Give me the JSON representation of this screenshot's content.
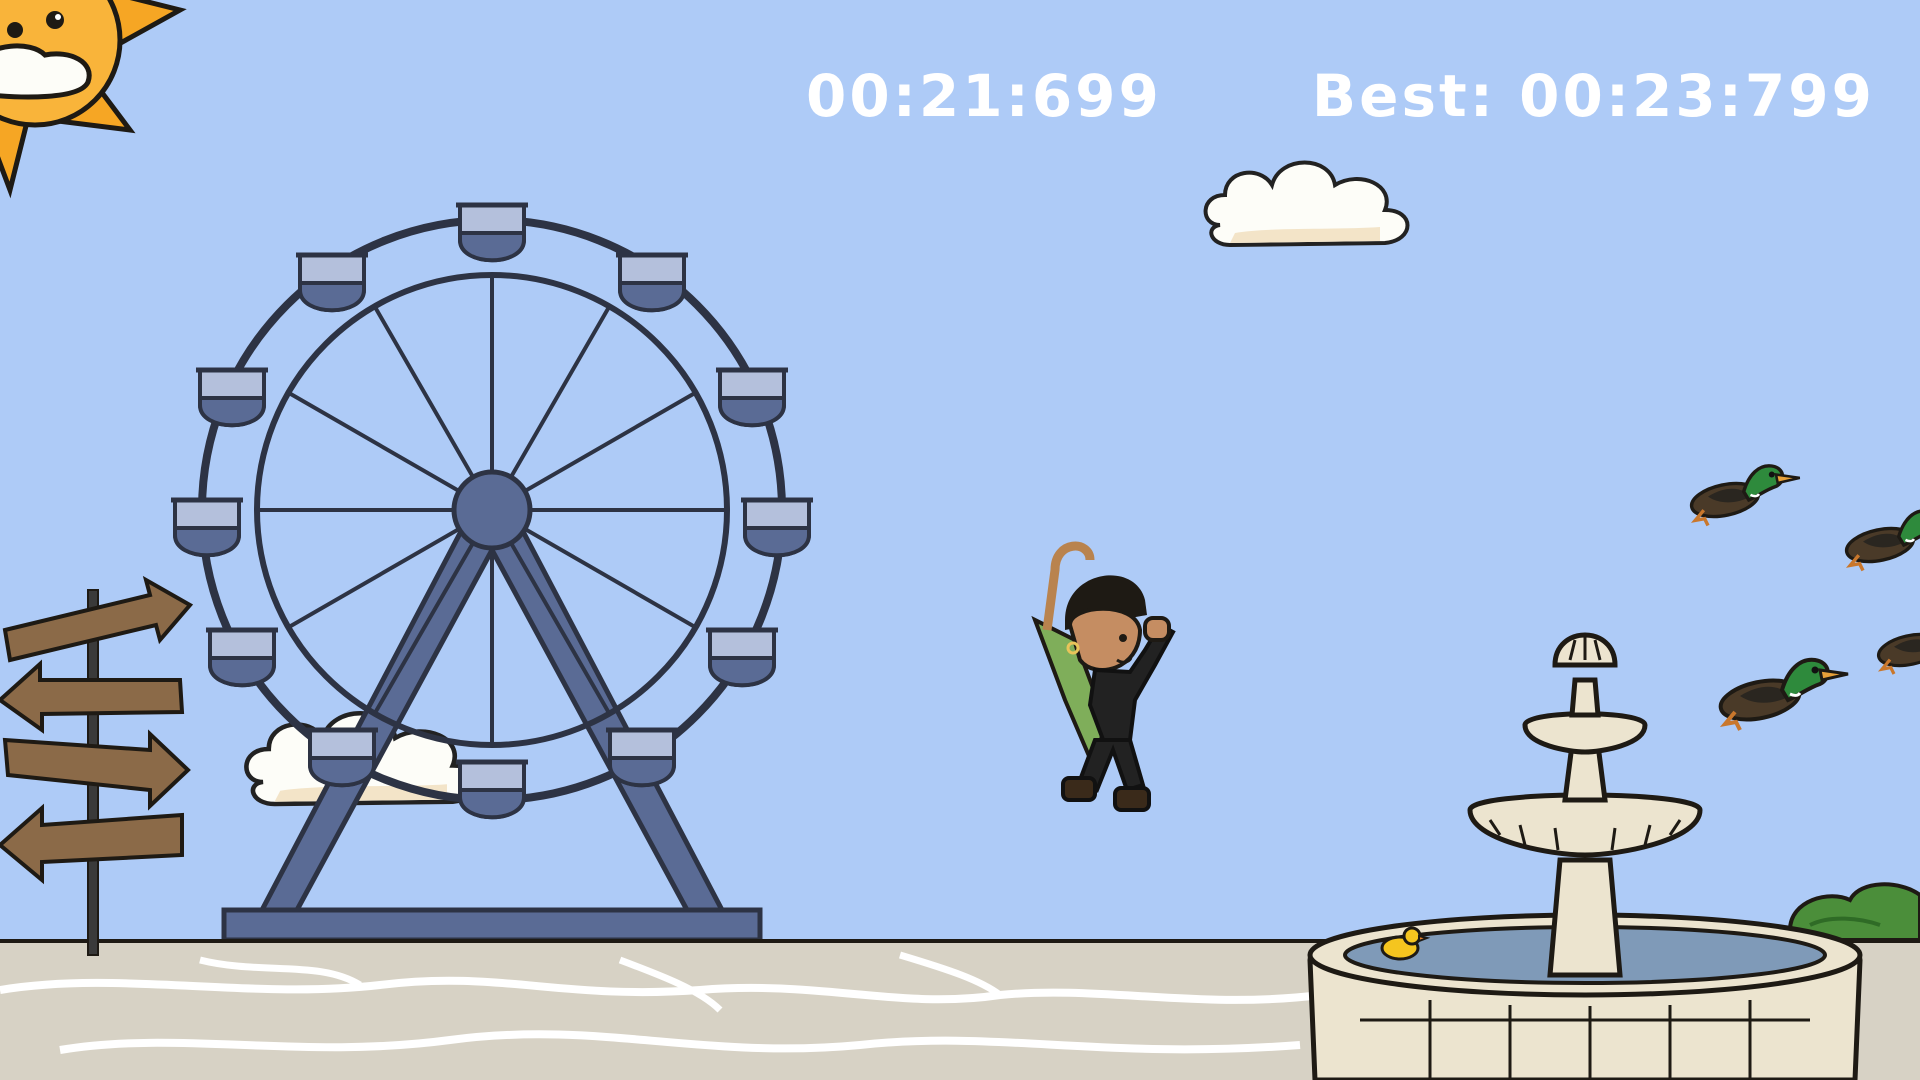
{
  "hud": {
    "current_time": "00:21:699",
    "best_label": "Best:",
    "best_time": "00:23:799"
  },
  "scene": {
    "sky_color": "#aecbf7",
    "ground_color": "#d7d2c5",
    "ferris_wheel_color": "#5a6b95",
    "icons": [
      "sun-icon",
      "cloud-icon",
      "ferris-wheel-icon",
      "signpost-icon",
      "player-character-icon",
      "umbrella-icon",
      "duck-icon",
      "fountain-icon",
      "rubber-duck-icon",
      "bush-icon"
    ]
  }
}
